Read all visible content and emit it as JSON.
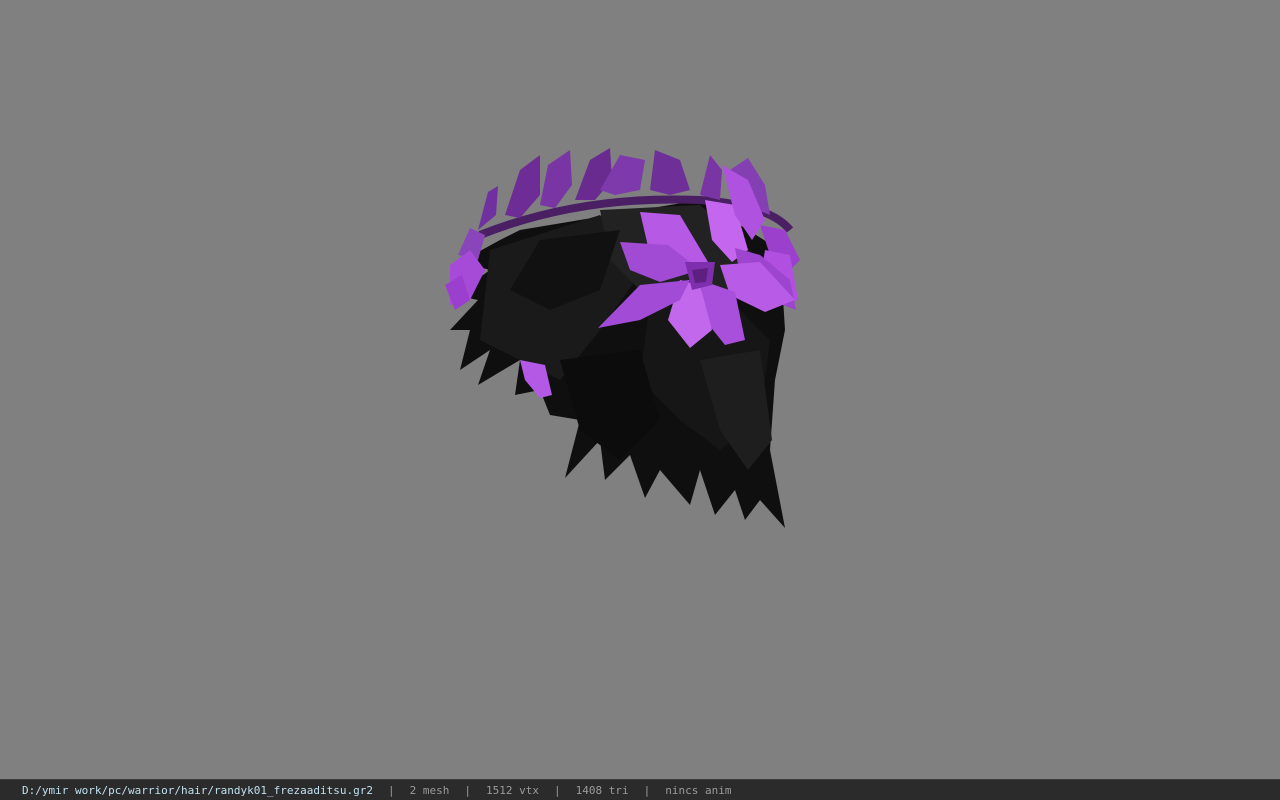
{
  "viewer": {
    "background_color": "#808080",
    "model": {
      "name": "hair-mesh-with-flower-wreath",
      "hair_color": "#141414",
      "flower_color": "#b04fe0",
      "flower_highlight": "#c466ee",
      "flower_shadow": "#7a2aa8"
    }
  },
  "status_bar": {
    "file_path": "D:/ymir work/pc/warrior/hair/randyk01_frezaaditsu.gr2",
    "separator": "|",
    "mesh_count": "2 mesh",
    "vertex_count": "1512 vtx",
    "triangle_count": "1408 tri",
    "anim_status": "nincs anim"
  }
}
